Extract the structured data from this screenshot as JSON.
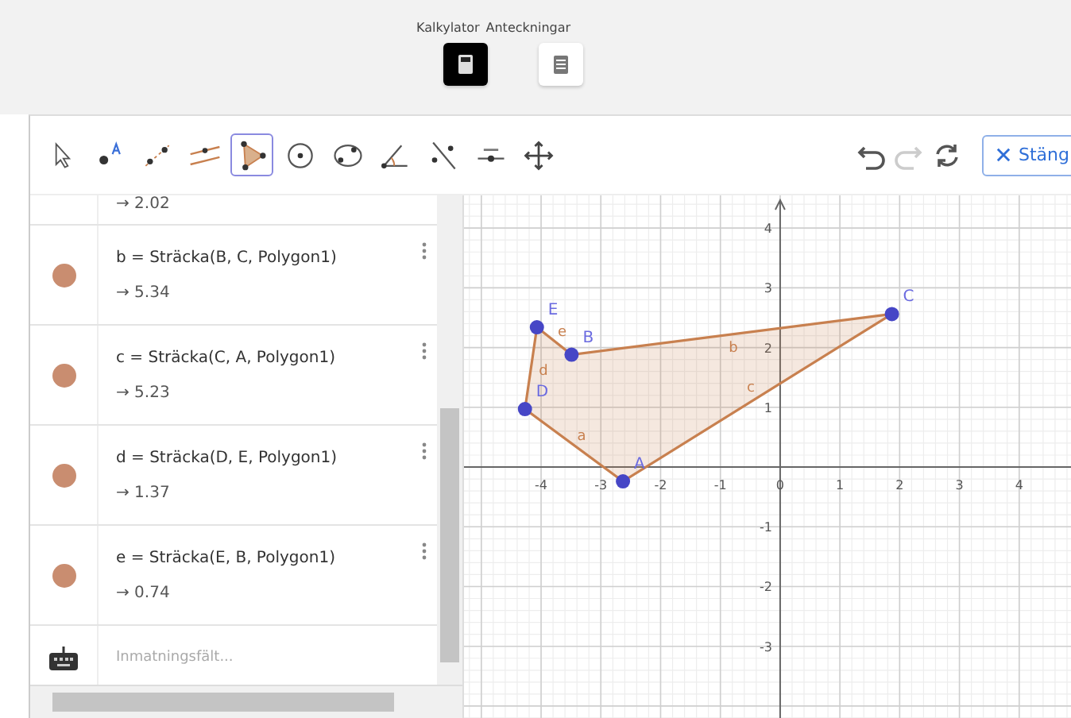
{
  "view_tabs": [
    {
      "label": "Kalkylator",
      "kind": "calculator",
      "selected": true
    },
    {
      "label": "Anteckningar",
      "kind": "notes",
      "selected": false
    }
  ],
  "tools": [
    {
      "kind": "move",
      "selected": false
    },
    {
      "kind": "point",
      "selected": false
    },
    {
      "kind": "line",
      "selected": false
    },
    {
      "kind": "parallel",
      "selected": false
    },
    {
      "kind": "polygon",
      "selected": true
    },
    {
      "kind": "circle",
      "selected": false
    },
    {
      "kind": "conic",
      "selected": false
    },
    {
      "kind": "angle",
      "selected": false
    },
    {
      "kind": "reflect",
      "selected": false
    },
    {
      "kind": "slider",
      "selected": false
    },
    {
      "kind": "pan",
      "selected": false
    }
  ],
  "history": [
    {
      "kind": "undo",
      "disabled": false
    },
    {
      "kind": "redo",
      "disabled": true
    },
    {
      "kind": "refresh",
      "disabled": false
    }
  ],
  "close_button": "Stäng",
  "algebra": {
    "rows": [
      {
        "partial": true,
        "value": "→ 2.02"
      },
      {
        "partial": false,
        "definition": "b = Sträcka(B, C, Polygon1)",
        "value": "→ 5.34"
      },
      {
        "partial": false,
        "definition": "c = Sträcka(C, A, Polygon1)",
        "value": "→ 5.23"
      },
      {
        "partial": false,
        "definition": "d = Sträcka(D, E, Polygon1)",
        "value": "→ 1.37"
      },
      {
        "partial": false,
        "definition": "e = Sträcka(E, B, Polygon1)",
        "value": "→ 0.74"
      }
    ],
    "input": {
      "placeholder": "Inmatningsfält..."
    }
  },
  "graphics": {
    "chart_data": {
      "type": "scatter",
      "x": [
        -2.63,
        -3.49,
        1.87,
        -4.27,
        -4.07
      ],
      "series": [
        {
          "color": "#4646c6",
          "values": [
            -0.24,
            1.88,
            2.56,
            0.97,
            2.34
          ]
        }
      ],
      "grid": true,
      "xlim": [
        -5.29,
        4.92
      ],
      "ylim": [
        -4.23,
        4.55
      ],
      "xticks": [
        -4,
        -3,
        -2,
        -1,
        0,
        1,
        2,
        3,
        4
      ],
      "yticks": [
        -3,
        -2,
        -1,
        1,
        2,
        3,
        4
      ]
    },
    "point_labels": [
      "A",
      "B",
      "C",
      "D",
      "E"
    ],
    "segment_labels": [
      "a",
      "d",
      "e",
      "b",
      "c"
    ]
  }
}
